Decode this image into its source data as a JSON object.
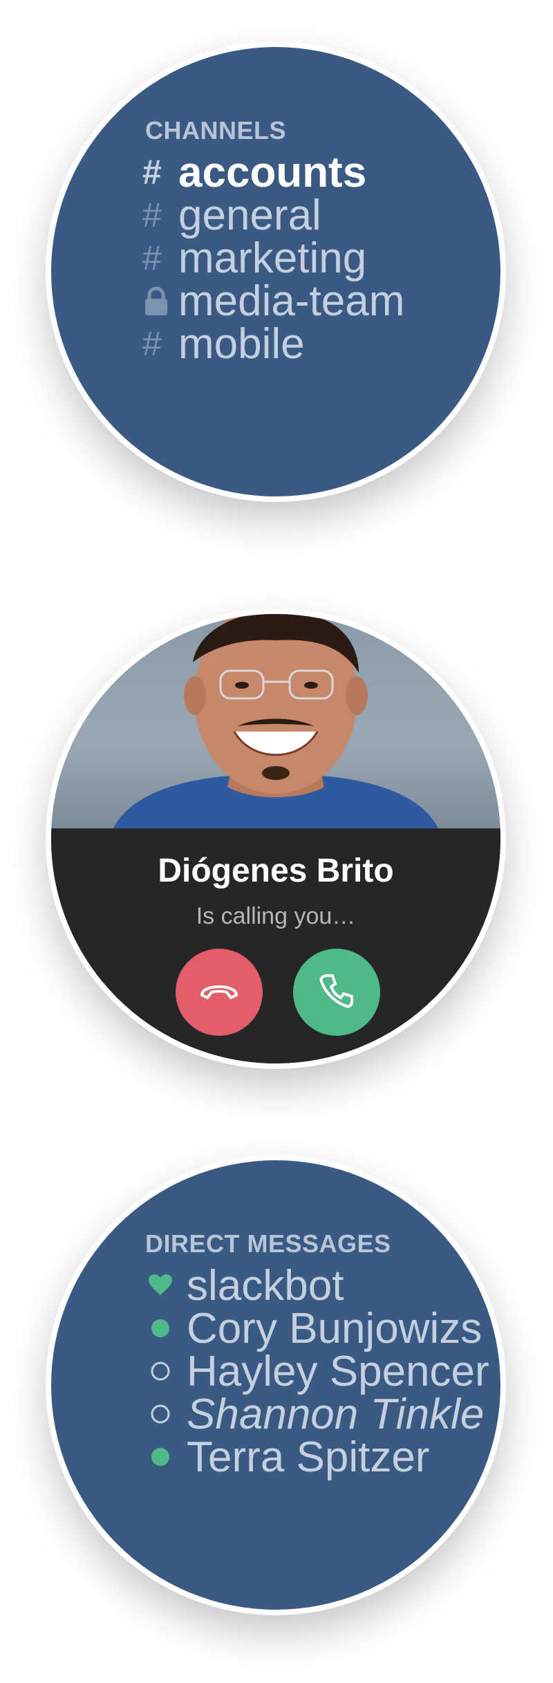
{
  "channels": {
    "title": "CHANNELS",
    "items": [
      {
        "label": "accounts",
        "icon": "hash-icon",
        "active": true
      },
      {
        "label": "general",
        "icon": "hash-icon",
        "active": false
      },
      {
        "label": "marketing",
        "icon": "hash-icon",
        "active": false
      },
      {
        "label": "media-team",
        "icon": "lock-icon",
        "active": false
      },
      {
        "label": "mobile",
        "icon": "hash-icon",
        "active": false
      }
    ]
  },
  "call": {
    "caller_name": "Diógenes Brito",
    "status_text": "Is calling you…",
    "decline_color": "#e35d6a",
    "accept_color": "#4fba87"
  },
  "direct_messages": {
    "title": "DIRECT MESSAGES",
    "items": [
      {
        "label": "slackbot",
        "status": "heart-icon"
      },
      {
        "label": "Cory Bunjowizs",
        "status": "online-dot-icon"
      },
      {
        "label": "Hayley Spencer",
        "status": "away-ring-icon"
      },
      {
        "label": "Shannon Tinkle",
        "status": "away-ring-icon"
      },
      {
        "label": "Terra Spitzer",
        "status": "online-dot-icon"
      }
    ]
  },
  "colors": {
    "sidebar_bg": "#3a5a83",
    "call_bg": "#252628",
    "online_green": "#4fba87",
    "text_light": "#c4d0e0"
  }
}
